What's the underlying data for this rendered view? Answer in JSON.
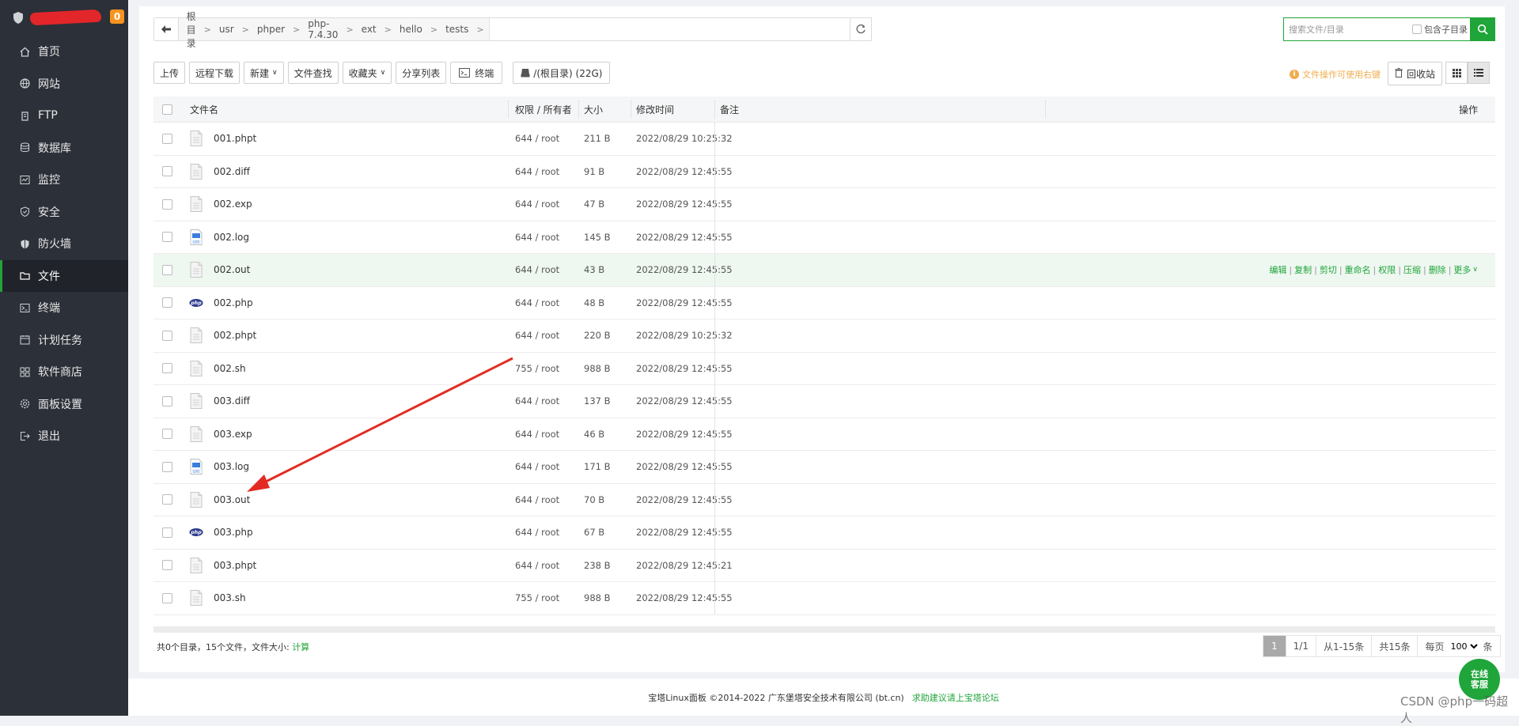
{
  "sidebar": {
    "badge": "0",
    "items": [
      {
        "label": "首页",
        "icon": "home-icon"
      },
      {
        "label": "网站",
        "icon": "globe-icon"
      },
      {
        "label": "FTP",
        "icon": "ftp-icon"
      },
      {
        "label": "数据库",
        "icon": "database-icon"
      },
      {
        "label": "监控",
        "icon": "monitor-icon"
      },
      {
        "label": "安全",
        "icon": "shield-icon"
      },
      {
        "label": "防火墙",
        "icon": "firewall-icon"
      },
      {
        "label": "文件",
        "icon": "folder-icon",
        "active": true
      },
      {
        "label": "终端",
        "icon": "terminal-icon"
      },
      {
        "label": "计划任务",
        "icon": "calendar-icon"
      },
      {
        "label": "软件商店",
        "icon": "apps-icon"
      },
      {
        "label": "面板设置",
        "icon": "gear-icon"
      },
      {
        "label": "退出",
        "icon": "logout-icon"
      }
    ]
  },
  "path": {
    "crumbs": [
      "根目录",
      "usr",
      "phper",
      "php-7.4.30",
      "ext",
      "hello",
      "tests"
    ]
  },
  "search": {
    "placeholder": "搜索文件/目录",
    "include_sub_label": "包含子目录"
  },
  "toolbar": {
    "upload": "上传",
    "remote_download": "远程下载",
    "new": "新建",
    "file_search": "文件查找",
    "favorites": "收藏夹",
    "share_list": "分享列表",
    "terminal": "终端",
    "disk": "/(根目录) (22G)",
    "tip": "文件操作可使用右键",
    "recycle": "回收站"
  },
  "table": {
    "headers": {
      "name": "文件名",
      "perm": "权限 / 所有者",
      "size": "大小",
      "mtime": "修改时间",
      "note": "备注",
      "ops": "操作"
    },
    "rows": [
      {
        "name": "001.phpt",
        "type": "file",
        "perm": "644 / root",
        "size": "211 B",
        "mtime": "2022/08/29 10:25:32"
      },
      {
        "name": "002.diff",
        "type": "file",
        "perm": "644 / root",
        "size": "91 B",
        "mtime": "2022/08/29 12:45:55"
      },
      {
        "name": "002.exp",
        "type": "file",
        "perm": "644 / root",
        "size": "47 B",
        "mtime": "2022/08/29 12:45:55"
      },
      {
        "name": "002.log",
        "type": "log",
        "perm": "644 / root",
        "size": "145 B",
        "mtime": "2022/08/29 12:45:55"
      },
      {
        "name": "002.out",
        "type": "file",
        "perm": "644 / root",
        "size": "43 B",
        "mtime": "2022/08/29 12:45:55"
      },
      {
        "name": "002.php",
        "type": "php",
        "perm": "644 / root",
        "size": "48 B",
        "mtime": "2022/08/29 12:45:55"
      },
      {
        "name": "002.phpt",
        "type": "file",
        "perm": "644 / root",
        "size": "220 B",
        "mtime": "2022/08/29 10:25:32"
      },
      {
        "name": "002.sh",
        "type": "file",
        "perm": "755 / root",
        "size": "988 B",
        "mtime": "2022/08/29 12:45:55"
      },
      {
        "name": "003.diff",
        "type": "file",
        "perm": "644 / root",
        "size": "137 B",
        "mtime": "2022/08/29 12:45:55"
      },
      {
        "name": "003.exp",
        "type": "file",
        "perm": "644 / root",
        "size": "46 B",
        "mtime": "2022/08/29 12:45:55"
      },
      {
        "name": "003.log",
        "type": "log",
        "perm": "644 / root",
        "size": "171 B",
        "mtime": "2022/08/29 12:45:55"
      },
      {
        "name": "003.out",
        "type": "file",
        "perm": "644 / root",
        "size": "70 B",
        "mtime": "2022/08/29 12:45:55"
      },
      {
        "name": "003.php",
        "type": "php",
        "perm": "644 / root",
        "size": "67 B",
        "mtime": "2022/08/29 12:45:55"
      },
      {
        "name": "003.phpt",
        "type": "file",
        "perm": "644 / root",
        "size": "238 B",
        "mtime": "2022/08/29 12:45:21"
      },
      {
        "name": "003.sh",
        "type": "file",
        "perm": "755 / root",
        "size": "988 B",
        "mtime": "2022/08/29 12:45:55"
      }
    ],
    "hover_ops": [
      "编辑",
      "复制",
      "剪切",
      "重命名",
      "权限",
      "压缩",
      "删除",
      "更多"
    ],
    "php_icon_text": "php",
    "log_icon_text": "LOG"
  },
  "summary": {
    "text": "共0个目录，15个文件，文件大小:",
    "calc": "计算"
  },
  "pager": {
    "current": "1",
    "pages": "1/1",
    "range": "从1-15条",
    "total": "共15条",
    "per_page_label": "每页",
    "per_page_value": "100",
    "unit": "条"
  },
  "footer": {
    "copyright": "宝塔Linux面板 ©2014-2022 广东堡塔安全技术有限公司 (bt.cn)",
    "forum_link": "求助建议请上宝塔论坛"
  },
  "chat": {
    "line1": "在线",
    "line2": "客服"
  },
  "watermark": "CSDN @php一码超人",
  "colors": {
    "accent": "#20a53a",
    "annotation_arrow": "#e32a22",
    "sidebar_bg": "#2c3038"
  }
}
